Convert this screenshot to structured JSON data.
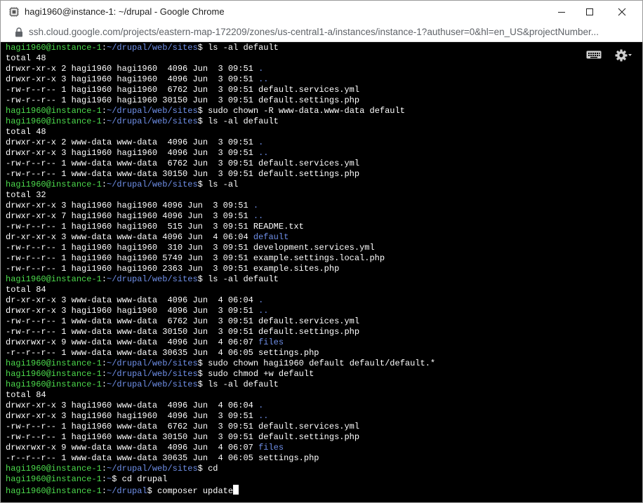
{
  "window": {
    "title": "hagi1960@instance-1: ~/drupal - Google Chrome",
    "url": "ssh.cloud.google.com/projects/eastern-map-172209/zones/us-central1-a/instances/instance-1?authuser=0&hl=en_US&projectNumber..."
  },
  "terminal": {
    "lines": [
      {
        "prompt": {
          "user": "hagi1960@instance-1",
          "sep": ":",
          "path": "~/drupal/web/sites",
          "sym": "$ "
        },
        "text": "ls -al default"
      },
      {
        "text": "total 48"
      },
      {
        "text": "drwxr-xr-x 2 hagi1960 hagi1960  4096 Jun  3 09:51 ",
        "dir": "."
      },
      {
        "text": "drwxr-xr-x 3 hagi1960 hagi1960  4096 Jun  3 09:51 ",
        "dir": ".."
      },
      {
        "text": "-rw-r--r-- 1 hagi1960 hagi1960  6762 Jun  3 09:51 default.services.yml"
      },
      {
        "text": "-rw-r--r-- 1 hagi1960 hagi1960 30150 Jun  3 09:51 default.settings.php"
      },
      {
        "prompt": {
          "user": "hagi1960@instance-1",
          "sep": ":",
          "path": "~/drupal/web/sites",
          "sym": "$ "
        },
        "text": "sudo chown -R www-data.www-data default"
      },
      {
        "prompt": {
          "user": "hagi1960@instance-1",
          "sep": ":",
          "path": "~/drupal/web/sites",
          "sym": "$ "
        },
        "text": "ls -al default"
      },
      {
        "text": "total 48"
      },
      {
        "text": "drwxr-xr-x 2 www-data www-data  4096 Jun  3 09:51 ",
        "dir": "."
      },
      {
        "text": "drwxr-xr-x 3 hagi1960 hagi1960  4096 Jun  3 09:51 ",
        "dir": ".."
      },
      {
        "text": "-rw-r--r-- 1 www-data www-data  6762 Jun  3 09:51 default.services.yml"
      },
      {
        "text": "-rw-r--r-- 1 www-data www-data 30150 Jun  3 09:51 default.settings.php"
      },
      {
        "prompt": {
          "user": "hagi1960@instance-1",
          "sep": ":",
          "path": "~/drupal/web/sites",
          "sym": "$ "
        },
        "text": "ls -al"
      },
      {
        "text": "total 32"
      },
      {
        "text": "drwxr-xr-x 3 hagi1960 hagi1960 4096 Jun  3 09:51 ",
        "dir": "."
      },
      {
        "text": "drwxr-xr-x 7 hagi1960 hagi1960 4096 Jun  3 09:51 ",
        "dir": ".."
      },
      {
        "text": "-rw-r--r-- 1 hagi1960 hagi1960  515 Jun  3 09:51 README.txt"
      },
      {
        "text": "dr-xr-xr-x 3 www-data www-data 4096 Jun  4 06:04 ",
        "dir": "default"
      },
      {
        "text": "-rw-r--r-- 1 hagi1960 hagi1960  310 Jun  3 09:51 development.services.yml"
      },
      {
        "text": "-rw-r--r-- 1 hagi1960 hagi1960 5749 Jun  3 09:51 example.settings.local.php"
      },
      {
        "text": "-rw-r--r-- 1 hagi1960 hagi1960 2363 Jun  3 09:51 example.sites.php"
      },
      {
        "prompt": {
          "user": "hagi1960@instance-1",
          "sep": ":",
          "path": "~/drupal/web/sites",
          "sym": "$ "
        },
        "text": "ls -al default"
      },
      {
        "text": "total 84"
      },
      {
        "text": "dr-xr-xr-x 3 www-data www-data  4096 Jun  4 06:04 ",
        "dir": "."
      },
      {
        "text": "drwxr-xr-x 3 hagi1960 hagi1960  4096 Jun  3 09:51 ",
        "dir": ".."
      },
      {
        "text": "-rw-r--r-- 1 www-data www-data  6762 Jun  3 09:51 default.services.yml"
      },
      {
        "text": "-rw-r--r-- 1 www-data www-data 30150 Jun  3 09:51 default.settings.php"
      },
      {
        "text": "drwxrwxr-x 9 www-data www-data  4096 Jun  4 06:07 ",
        "dir": "files"
      },
      {
        "text": "-r--r--r-- 1 www-data www-data 30635 Jun  4 06:05 settings.php"
      },
      {
        "prompt": {
          "user": "hagi1960@instance-1",
          "sep": ":",
          "path": "~/drupal/web/sites",
          "sym": "$ "
        },
        "text": "sudo chown hagi1960 default default/default.*"
      },
      {
        "prompt": {
          "user": "hagi1960@instance-1",
          "sep": ":",
          "path": "~/drupal/web/sites",
          "sym": "$ "
        },
        "text": "sudo chmod +w default"
      },
      {
        "prompt": {
          "user": "hagi1960@instance-1",
          "sep": ":",
          "path": "~/drupal/web/sites",
          "sym": "$ "
        },
        "text": "ls -al default"
      },
      {
        "text": "total 84"
      },
      {
        "text": "drwxr-xr-x 3 hagi1960 www-data  4096 Jun  4 06:04 ",
        "dir": "."
      },
      {
        "text": "drwxr-xr-x 3 hagi1960 hagi1960  4096 Jun  3 09:51 ",
        "dir": ".."
      },
      {
        "text": "-rw-r--r-- 1 hagi1960 www-data  6762 Jun  3 09:51 default.services.yml"
      },
      {
        "text": "-rw-r--r-- 1 hagi1960 www-data 30150 Jun  3 09:51 default.settings.php"
      },
      {
        "text": "drwxrwxr-x 9 www-data www-data  4096 Jun  4 06:07 ",
        "dir": "files"
      },
      {
        "text": "-r--r--r-- 1 www-data www-data 30635 Jun  4 06:05 settings.php"
      },
      {
        "prompt": {
          "user": "hagi1960@instance-1",
          "sep": ":",
          "path": "~/drupal/web/sites",
          "sym": "$ "
        },
        "text": "cd"
      },
      {
        "prompt": {
          "user": "hagi1960@instance-1",
          "sep": ":",
          "path": "~",
          "sym": "$ "
        },
        "text": "cd drupal"
      },
      {
        "prompt": {
          "user": "hagi1960@instance-1",
          "sep": ":",
          "path": "~/drupal",
          "sym": "$ "
        },
        "text": "composer update",
        "cursor": true
      }
    ]
  },
  "icons": {
    "keyboard": "keyboard-icon",
    "settings": "gear-icon",
    "lock": "lock-icon",
    "app": "terminal-app-icon"
  },
  "colors": {
    "terminal_bg": "#000000",
    "prompt_user": "#4ddc4d",
    "prompt_path": "#6f8fe8",
    "text": "#ffffff"
  }
}
